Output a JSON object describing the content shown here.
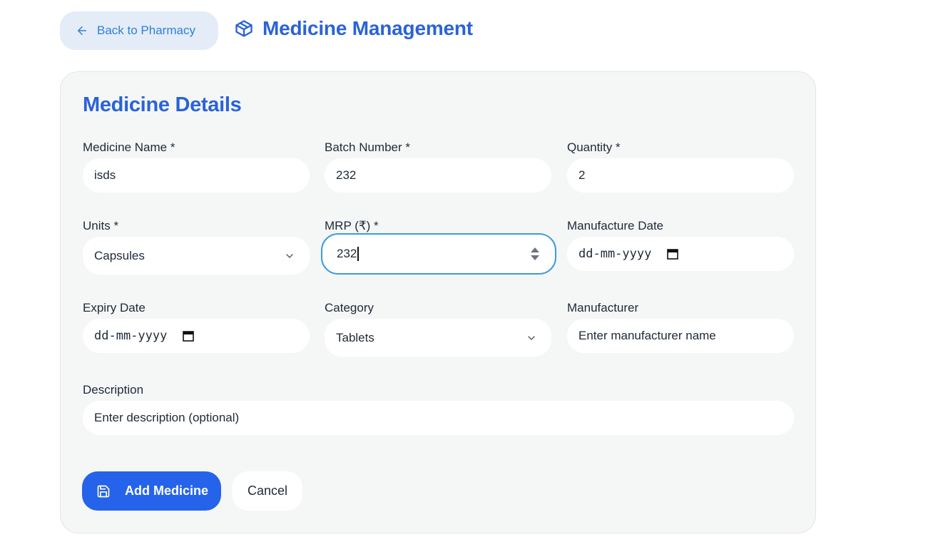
{
  "header": {
    "back_label": "Back to Pharmacy",
    "title": "Medicine Management",
    "icon": "package-icon"
  },
  "form": {
    "title": "Medicine Details",
    "medicine_name": {
      "label": "Medicine Name *",
      "value": "isds"
    },
    "batch_number": {
      "label": "Batch Number *",
      "value": "232"
    },
    "quantity": {
      "label": "Quantity *",
      "value": "2"
    },
    "units": {
      "label": "Units *",
      "value": "Capsules"
    },
    "mrp": {
      "label": "MRP (₹) *",
      "value": "232"
    },
    "manufacture_date": {
      "label": "Manufacture Date",
      "placeholder": "dd-mm-yyyy"
    },
    "expiry_date": {
      "label": "Expiry Date",
      "placeholder": "dd-mm-yyyy"
    },
    "category": {
      "label": "Category",
      "value": "Tablets"
    },
    "manufacturer": {
      "label": "Manufacturer",
      "placeholder": "Enter manufacturer name"
    },
    "description": {
      "label": "Description",
      "placeholder": "Enter description (optional)"
    }
  },
  "actions": {
    "submit_label": "Add Medicine",
    "cancel_label": "Cancel"
  },
  "colors": {
    "accent": "#2563eb",
    "title_blue": "#2a63d6",
    "back_button_bg": "#e3ecf7",
    "focus_ring": "#3b9be0",
    "card_bg": "#f5f7f7"
  }
}
